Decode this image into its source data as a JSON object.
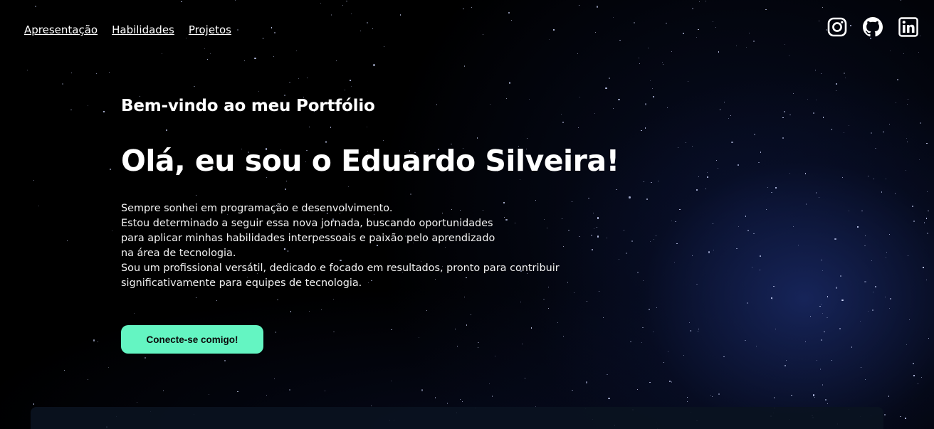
{
  "nav": {
    "items": [
      {
        "label": "Apresentação"
      },
      {
        "label": "Habilidades"
      },
      {
        "label": "Projetos"
      }
    ]
  },
  "social": {
    "icons": [
      "instagram-icon",
      "github-icon",
      "linkedin-icon"
    ]
  },
  "hero": {
    "subtitle": "Bem-vindo ao meu Portfólio",
    "title": "Olá, eu sou o Eduardo Silveira!",
    "description_lines": [
      "Sempre sonhei em programação e desenvolvimento.",
      "Estou determinado a seguir essa nova jornada, buscando oportunidades",
      "para aplicar minhas habilidades interpessoais e paixão pelo aprendizado",
      "na área de tecnologia.",
      "Sou um profissional versátil, dedicado e focado em resultados, pronto para contribuir",
      "significativamente para equipes de tecnologia."
    ],
    "cta_label": "Conecte-se comigo!"
  },
  "colors": {
    "accent": "#64f5c2",
    "background": "#000000",
    "nebula": "#1c2d6e"
  }
}
